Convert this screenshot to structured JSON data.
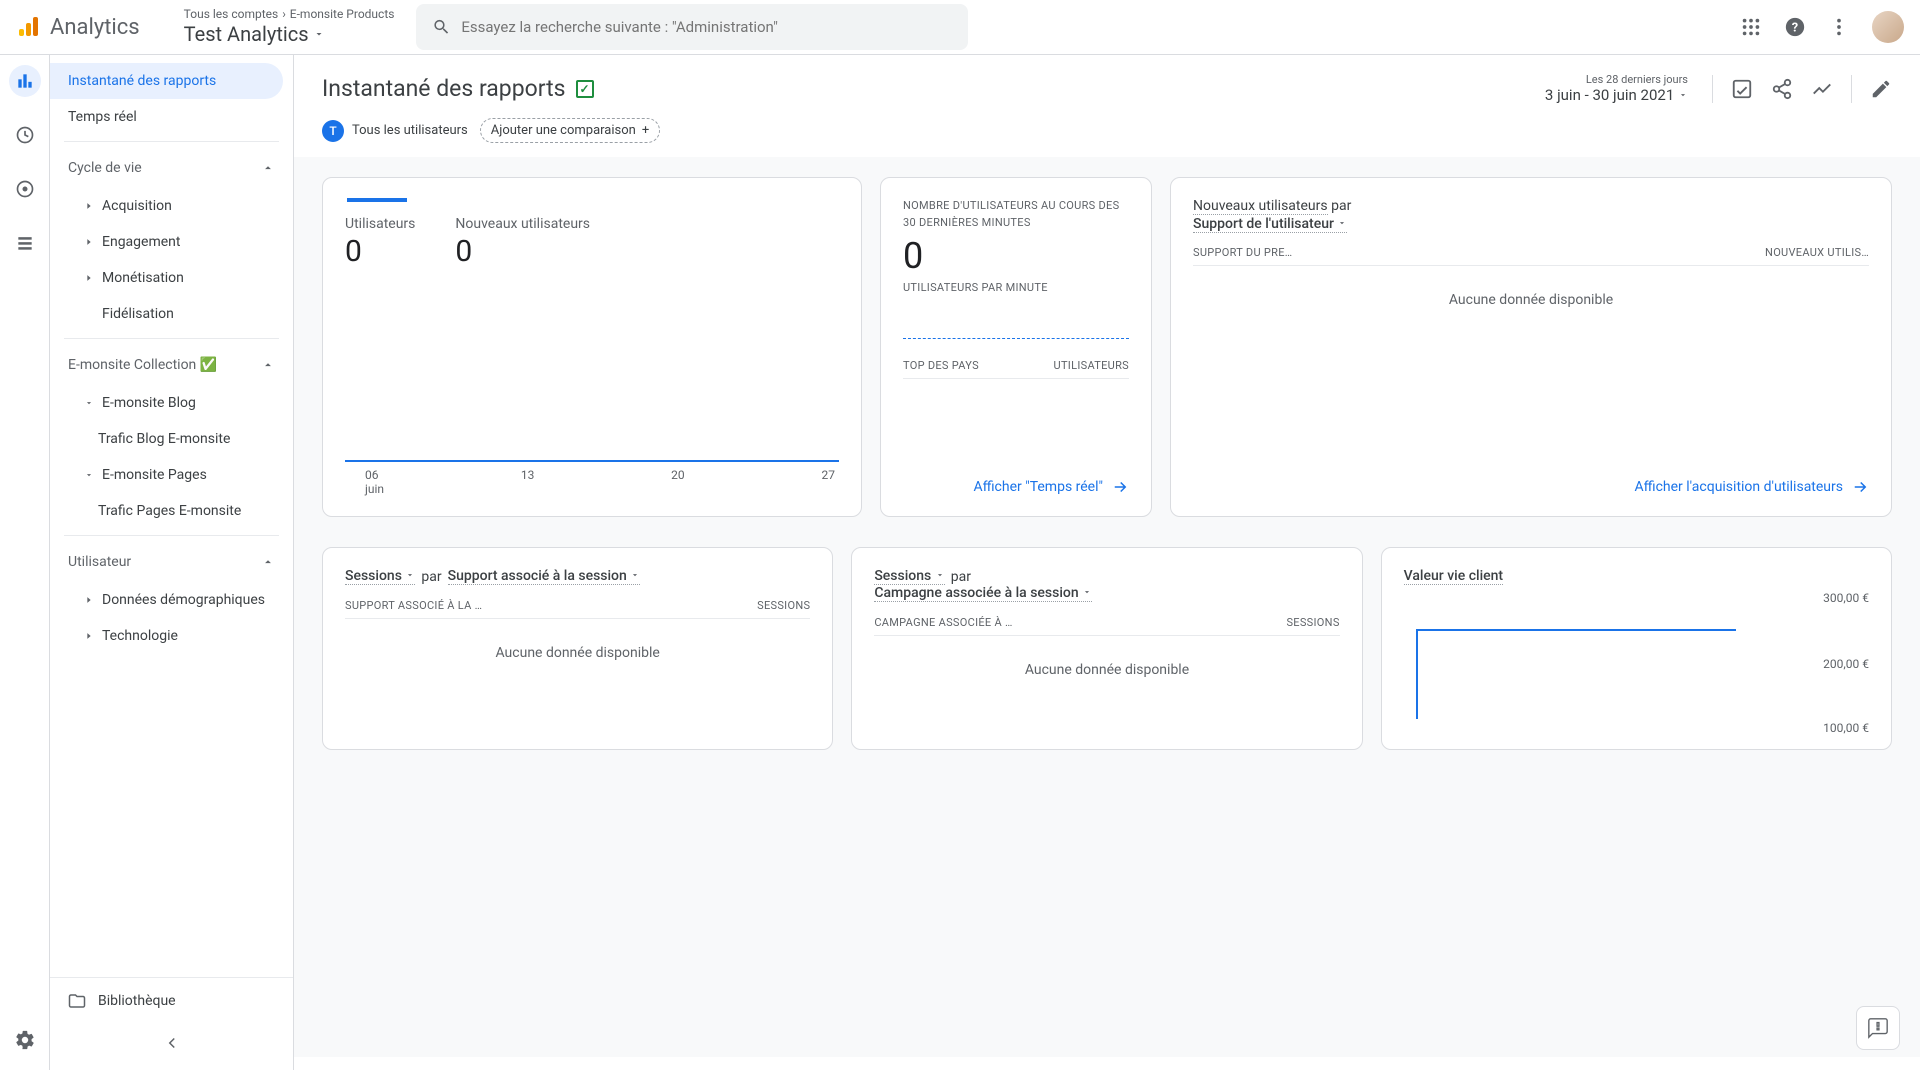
{
  "topbar": {
    "product": "Analytics",
    "breadcrumb_accounts": "Tous les comptes",
    "breadcrumb_product": "E-monsite Products",
    "property": "Test Analytics",
    "search_placeholder": "Essayez la recherche suivante : \"Administration\""
  },
  "sidebar": {
    "snapshot": "Instantané des rapports",
    "realtime": "Temps réel",
    "lifecycle": "Cycle de vie",
    "acquisition": "Acquisition",
    "engagement": "Engagement",
    "monetization": "Monétisation",
    "retention": "Fidélisation",
    "collection": "E-monsite Collection ✅",
    "blog": "E-monsite Blog",
    "blog_traffic": "Trafic Blog E-monsite",
    "pages": "E-monsite Pages",
    "pages_traffic": "Trafic Pages E-monsite",
    "user": "Utilisateur",
    "demographics": "Données démographiques",
    "technology": "Technologie",
    "library": "Bibliothèque"
  },
  "page": {
    "title": "Instantané des rapports",
    "date_label": "Les 28 derniers jours",
    "date_range": "3 juin - 30 juin 2021",
    "all_users": "Tous les utilisateurs",
    "add_comparison": "Ajouter une comparaison"
  },
  "card_users": {
    "m1_label": "Utilisateurs",
    "m1_value": "0",
    "m2_label": "Nouveaux utilisateurs",
    "m2_value": "0",
    "xaxis": [
      "06",
      "13",
      "20",
      "27"
    ],
    "xaxis_month": "juin"
  },
  "card_realtime": {
    "header": "NOMBRE D'UTILISATEURS AU COURS DES 30 DERNIÈRES MINUTES",
    "value": "0",
    "upm": "UTILISATEURS PAR MINUTE",
    "col1": "TOP DES PAYS",
    "col2": "UTILISATEURS",
    "link": "Afficher \"Temps réel\""
  },
  "card_newusers": {
    "line1_a": "Nouveaux utilisateurs",
    "line1_b": "par",
    "dropdown": "Support de l'utilisateur",
    "col1": "SUPPORT DU PRE…",
    "col2": "NOUVEAUX UTILIS…",
    "nodata": "Aucune donnée disponible",
    "link": "Afficher l'acquisition d'utilisateurs"
  },
  "card_sessions_medium": {
    "dd1": "Sessions",
    "by": "par",
    "dd2": "Support associé à la session",
    "col1": "SUPPORT ASSOCIÉ À LA …",
    "col2": "SESSIONS",
    "nodata": "Aucune donnée disponible"
  },
  "card_sessions_campaign": {
    "dd1": "Sessions",
    "by": "par",
    "dd2": "Campagne associée à la session",
    "col1": "CAMPAGNE ASSOCIÉE À …",
    "col2": "SESSIONS",
    "nodata": "Aucune donnée disponible"
  },
  "card_clv": {
    "title": "Valeur vie client",
    "y1": "300,00 €",
    "y2": "200,00 €",
    "y3": "100,00 €"
  },
  "chart_data": [
    {
      "type": "line",
      "title": "Utilisateurs",
      "categories": [
        "06 juin",
        "13 juin",
        "20 juin",
        "27 juin"
      ],
      "series": [
        {
          "name": "Utilisateurs",
          "values": [
            0,
            0,
            0,
            0
          ]
        }
      ],
      "ylim": [
        0,
        1
      ]
    },
    {
      "type": "line",
      "title": "Valeur vie client",
      "x": [],
      "series": [
        {
          "name": "Valeur vie client",
          "values": []
        }
      ],
      "ylabel": "€",
      "ylim": [
        0,
        300
      ],
      "yticks": [
        100,
        200,
        300
      ]
    }
  ]
}
